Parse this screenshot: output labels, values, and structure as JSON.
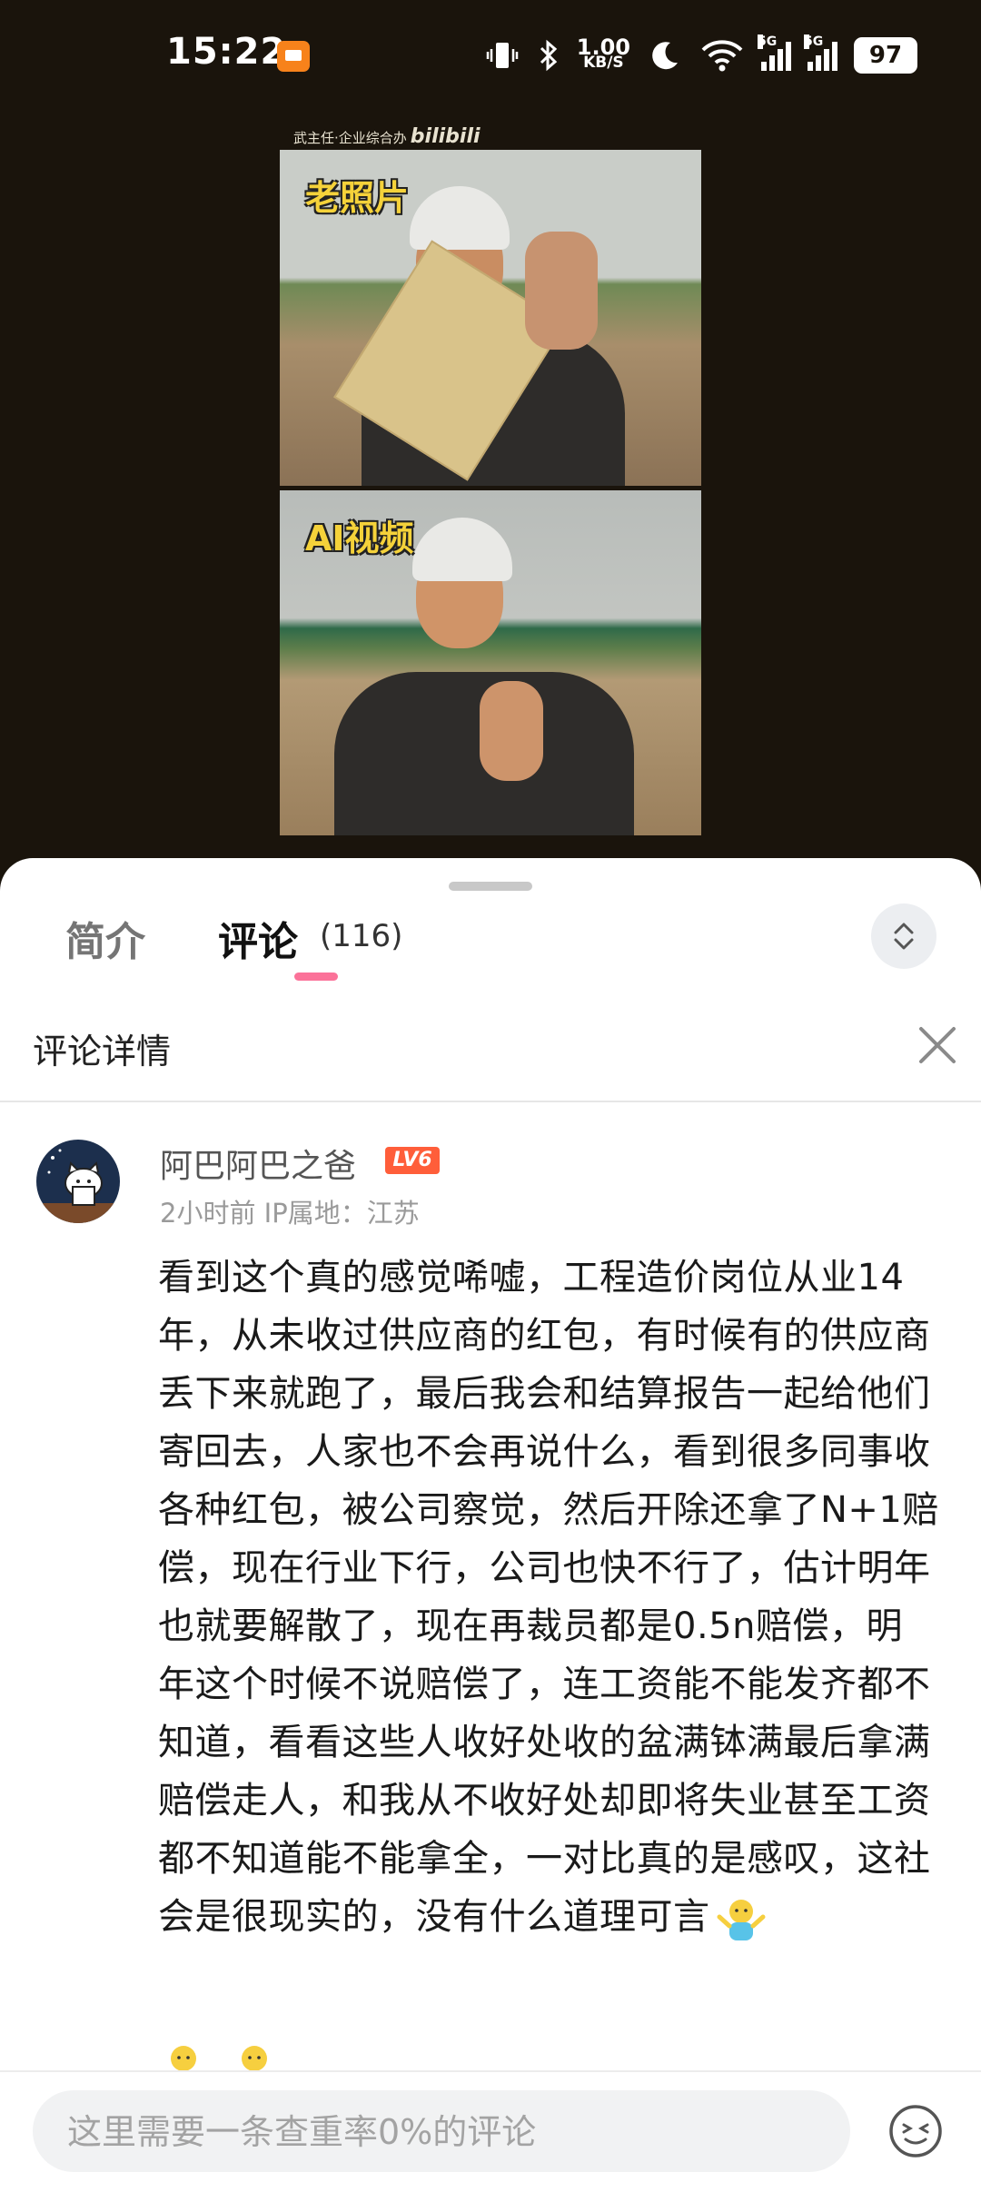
{
  "status_bar": {
    "time": "15:22",
    "network_speed": "1.00",
    "network_speed_unit": "KB/S",
    "signal_1": "5G",
    "signal_2": "5G",
    "battery": "97"
  },
  "video": {
    "watermark_author": "武主任·企业综合办",
    "watermark_brand": "bilibili",
    "frame_top_caption": "老照片",
    "frame_bottom_caption": "AI视频"
  },
  "tabs": {
    "intro": "简介",
    "comments": "评论",
    "comments_count": "(116)"
  },
  "detail": {
    "title": "评论详情"
  },
  "comment": {
    "username": "阿巴阿巴之爸",
    "level": "LV6",
    "time": "2小时前",
    "ip_label": "IP属地：江苏",
    "text": "看到这个真的感觉唏嘘，工程造价岗位从业14年，从未收过供应商的红包，有时候有的供应商丢下来就跑了，最后我会和结算报告一起给他们寄回去，人家也不会再说什么，看到很多同事收各种红包，被公司察觉，然后开除还拿了N+1赔偿，现在行业下行，公司也快不行了，估计明年也就要解散了，现在再裁员都是0.5n赔偿，明年这个时候不说赔偿了，连工资能不能发齐都不知道，看看这些人收好处收的盆满钵满最后拿满赔偿走人，和我从不收好处却即将失业甚至工资都不知道能不能拿全，一对比真的是感叹，这社会是很现实的，没有什么道理可言"
  },
  "input": {
    "placeholder": "这里需要一条查重率0%的评论"
  },
  "colors": {
    "accent_pink": "#fb7299",
    "level_badge": "#ff5e3a",
    "video_bg": "#1a140c",
    "caption_yellow": "#f5d23a"
  }
}
